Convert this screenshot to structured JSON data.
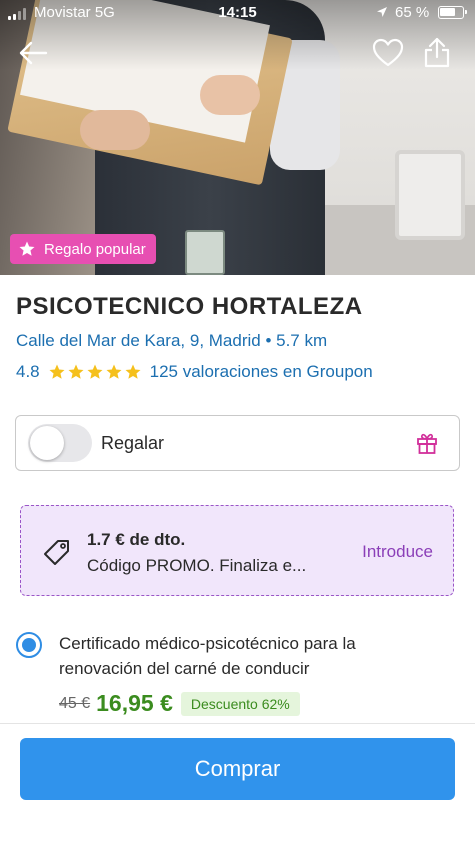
{
  "status_bar": {
    "carrier": "Movistar  5G",
    "time": "14:15",
    "battery": "65 %"
  },
  "hero": {
    "badge": "Regalo popular",
    "icons": [
      "back-arrow-icon",
      "heart-icon",
      "share-icon",
      "star-icon"
    ]
  },
  "deal": {
    "title": "PSICOTECNICO HORTALEZA",
    "address": "Calle del Mar de Kara, 9, Madrid • 5.7 km",
    "rating": "4.8",
    "stars": 5,
    "reviews": "125 valoraciones en Groupon"
  },
  "gift": {
    "label": "Regalar",
    "enabled": false,
    "icon": "gift-icon"
  },
  "promo": {
    "amount": "1.7 € de dto.",
    "code": "Código PROMO. Finaliza e...",
    "action": "Introduce",
    "icon": "tag-icon"
  },
  "option": {
    "text": "Certificado médico-psicotécnico para la renovación del carné de conducir",
    "old_price": "45 €",
    "new_price": "16,95 €",
    "discount": "Descuento 62%",
    "selected": true
  },
  "cta": {
    "label": "Comprar"
  },
  "colors": {
    "link_blue": "#1c6fb0",
    "button_blue": "#3093ec",
    "badge_pink": "#e74fb2",
    "promo_purple": "#8b3fb8",
    "price_green": "#3b8c1f",
    "star_yellow": "#f5c01c"
  }
}
